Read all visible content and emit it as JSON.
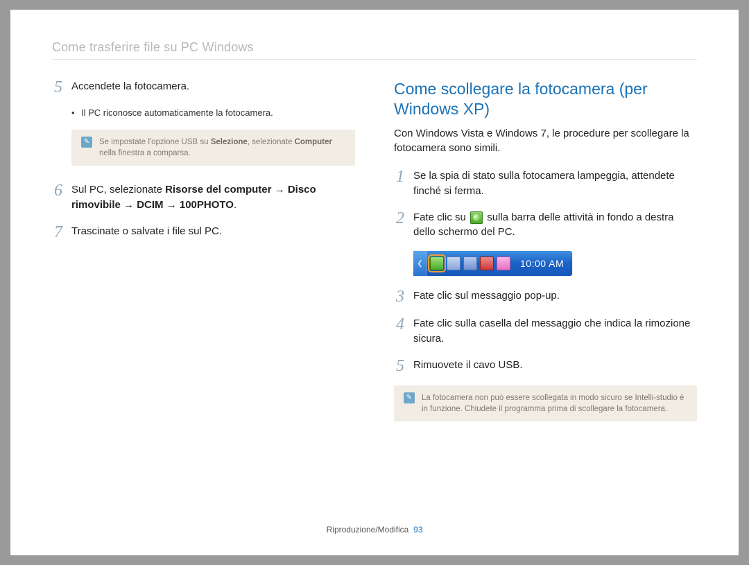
{
  "page_title": "Come trasferire file su PC Windows",
  "left": {
    "steps": [
      {
        "num": "5",
        "text": "Accendete la fotocamera.",
        "bullet": "Il PC riconosce automaticamente la fotocamera.",
        "note_parts": {
          "a": "Se impostate l'opzione USB su ",
          "b": "Selezione",
          "c": ", selezionate ",
          "d": "Computer",
          "e": " nella finestra a comparsa."
        }
      },
      {
        "num": "6",
        "parts": {
          "a": "Sul PC, selezionate ",
          "b": "Risorse del computer",
          "arrow1": " → ",
          "c": "Disco rimovibile",
          "arrow2": " → ",
          "d": "DCIM",
          "arrow3": " → ",
          "e": "100PHOTO",
          "f": "."
        }
      },
      {
        "num": "7",
        "text": "Trascinate o salvate i file sul PC."
      }
    ]
  },
  "right": {
    "section_title": "Come scollegare la fotocamera (per Windows XP)",
    "intro": "Con Windows Vista e Windows 7, le procedure per scollegare la fotocamera sono simili.",
    "steps": [
      {
        "num": "1",
        "text": "Se la spia di stato sulla fotocamera lampeggia, attendete finché si ferma."
      },
      {
        "num": "2",
        "pre": "Fate clic su ",
        "post": " sulla barra delle attività in fondo a destra dello schermo del PC."
      },
      {
        "num": "3",
        "text": "Fate clic sul messaggio pop-up."
      },
      {
        "num": "4",
        "text": "Fate clic sulla casella del messaggio che indica la rimozione sicura."
      },
      {
        "num": "5",
        "text": "Rimuovete il cavo USB."
      }
    ],
    "clock": "10:00 AM",
    "note": "La fotocamera non può essere scollegata in modo sicuro se Intelli-studio è in funzione. Chiudete il programma prima di scollegare la fotocamera."
  },
  "footer": {
    "label": "Riproduzione/Modifica",
    "page": "93"
  }
}
